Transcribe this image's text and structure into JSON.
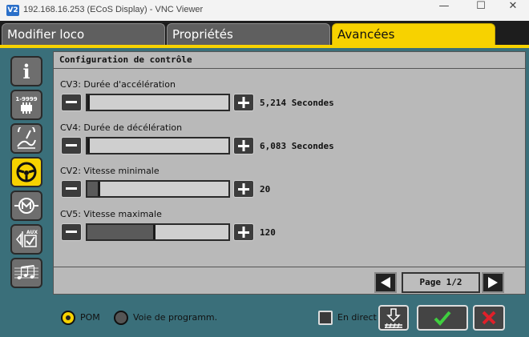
{
  "window": {
    "logo": "V2",
    "title": "192.168.16.253 (ECoS Display) - VNC Viewer",
    "minimize": "—",
    "maximize": "☐",
    "close": "✕"
  },
  "tabs": [
    {
      "label": "Modifier loco"
    },
    {
      "label": "Propriétés"
    },
    {
      "label": "Avancées"
    }
  ],
  "sidebar": {
    "info_label": "i",
    "address_label": "1-9999"
  },
  "section": {
    "title": "Configuration de contrôle"
  },
  "cvs": [
    {
      "label": "CV3: Durée d'accélération",
      "value": "5,214 Secondes",
      "level": 0.0
    },
    {
      "label": "CV4: Durée de décélération",
      "value": "6,083 Secondes",
      "level": 0.0
    },
    {
      "label": "CV2: Vitesse minimale",
      "value": "20",
      "level": 0.078
    },
    {
      "label": "CV5: Vitesse maximale",
      "value": "120",
      "level": 0.47
    }
  ],
  "pager": {
    "label": "Page 1/2"
  },
  "bottom": {
    "pom_label": "POM",
    "prog_label": "Voie de programm.",
    "direct_label": "En direct"
  },
  "colors": {
    "accent": "#f7d200",
    "panel": "#b9b9b9",
    "frame": "#3a6f7a",
    "ok": "#3fcf3f",
    "cancel": "#e0202a"
  }
}
